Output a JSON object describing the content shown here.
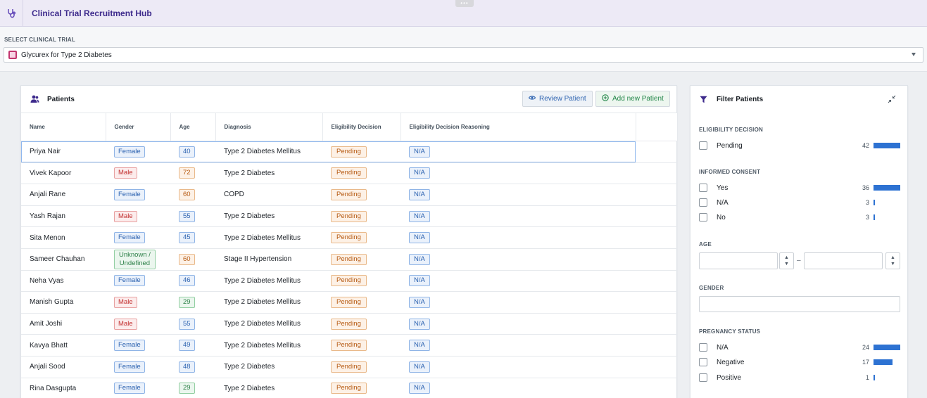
{
  "app": {
    "title": "Clinical Trial Recruitment Hub",
    "icon": "stethoscope-icon",
    "accent": "#3d2a8c"
  },
  "trial_selector": {
    "label": "SELECT CLINICAL TRIAL",
    "value": "Glycurex for Type 2 Diabetes"
  },
  "patients": {
    "title": "Patients",
    "review_label": "Review Patient",
    "add_label": "Add new Patient",
    "columns": [
      "Name",
      "Gender",
      "Age",
      "Diagnosis",
      "Eligibility Decision",
      "Eligibility Decision Reasoning"
    ],
    "rows": [
      {
        "name": "Priya Nair",
        "gender": "Female",
        "age": "40",
        "diagnosis": "Type 2 Diabetes Mellitus",
        "decision": "Pending",
        "reasoning": "N/A"
      },
      {
        "name": "Vivek Kapoor",
        "gender": "Male",
        "age": "72",
        "diagnosis": "Type 2 Diabetes",
        "decision": "Pending",
        "reasoning": "N/A"
      },
      {
        "name": "Anjali Rane",
        "gender": "Female",
        "age": "60",
        "diagnosis": "COPD",
        "decision": "Pending",
        "reasoning": "N/A"
      },
      {
        "name": "Yash Rajan",
        "gender": "Male",
        "age": "55",
        "diagnosis": "Type 2 Diabetes",
        "decision": "Pending",
        "reasoning": "N/A"
      },
      {
        "name": "Sita Menon",
        "gender": "Female",
        "age": "45",
        "diagnosis": "Type 2 Diabetes Mellitus",
        "decision": "Pending",
        "reasoning": "N/A"
      },
      {
        "name": "Sameer Chauhan",
        "gender_line1": "Unknown /",
        "gender_line2": "Undefined",
        "age": "60",
        "diagnosis": "Stage II Hypertension",
        "decision": "Pending",
        "reasoning": "N/A"
      },
      {
        "name": "Neha Vyas",
        "gender": "Female",
        "age": "46",
        "diagnosis": "Type 2 Diabetes Mellitus",
        "decision": "Pending",
        "reasoning": "N/A"
      },
      {
        "name": "Manish Gupta",
        "gender": "Male",
        "age": "29",
        "diagnosis": "Type 2 Diabetes Mellitus",
        "decision": "Pending",
        "reasoning": "N/A"
      },
      {
        "name": "Amit Joshi",
        "gender": "Male",
        "age": "55",
        "diagnosis": "Type 2 Diabetes Mellitus",
        "decision": "Pending",
        "reasoning": "N/A"
      },
      {
        "name": "Kavya Bhatt",
        "gender": "Female",
        "age": "49",
        "diagnosis": "Type 2 Diabetes Mellitus",
        "decision": "Pending",
        "reasoning": "N/A"
      },
      {
        "name": "Anjali Sood",
        "gender": "Female",
        "age": "48",
        "diagnosis": "Type 2 Diabetes",
        "decision": "Pending",
        "reasoning": "N/A"
      },
      {
        "name": "Rina Dasgupta",
        "gender": "Female",
        "age": "29",
        "diagnosis": "Type 2 Diabetes",
        "decision": "Pending",
        "reasoning": "N/A"
      }
    ]
  },
  "filters": {
    "title": "Filter Patients",
    "eligibility": {
      "label": "ELIGIBILITY DECISION",
      "options": [
        {
          "label": "Pending",
          "count": "42"
        }
      ]
    },
    "consent": {
      "label": "INFORMED CONSENT",
      "options": [
        {
          "label": "Yes",
          "count": "36"
        },
        {
          "label": "N/A",
          "count": "3"
        },
        {
          "label": "No",
          "count": "3"
        }
      ]
    },
    "age": {
      "label": "AGE",
      "separator": "–"
    },
    "gender": {
      "label": "GENDER"
    },
    "pregnancy": {
      "label": "PREGNANCY STATUS",
      "options": [
        {
          "label": "N/A",
          "count": "24"
        },
        {
          "label": "Negative",
          "count": "17"
        },
        {
          "label": "Positive",
          "count": "1"
        }
      ]
    },
    "bar_color": "#2d72d2"
  }
}
